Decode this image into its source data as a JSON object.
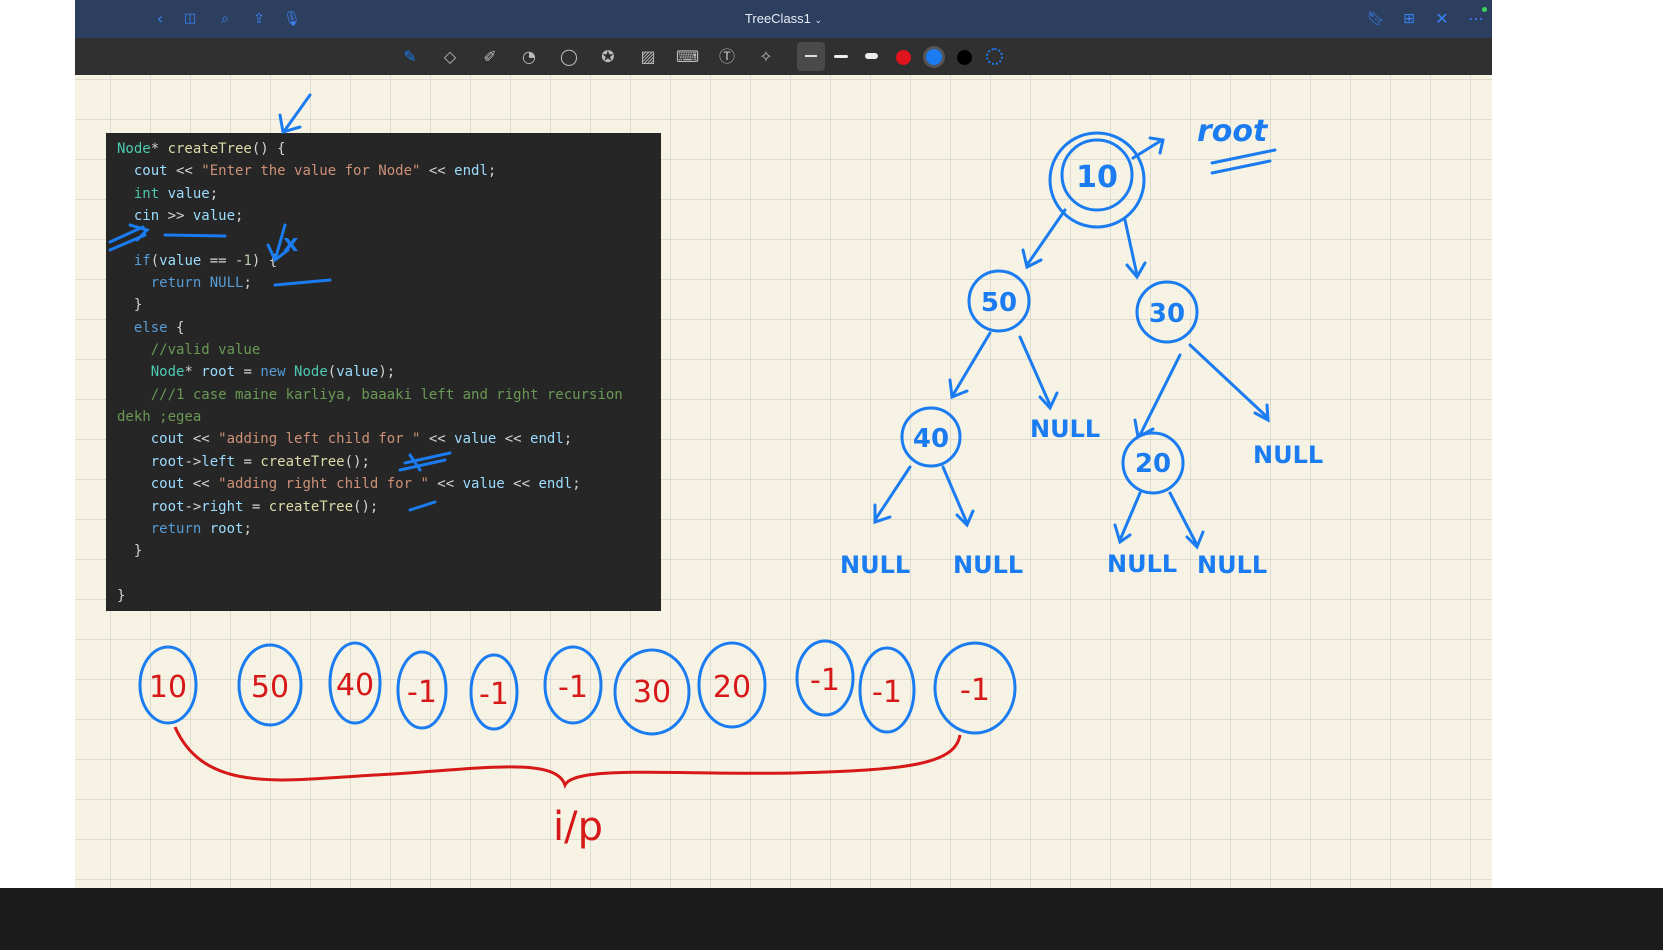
{
  "titlebar": {
    "title": "TreeClass1",
    "title_chevron": "⌄",
    "left_icons": [
      "back-icon",
      "sidebar-icon",
      "search-icon",
      "share-icon",
      "microphone-icon"
    ],
    "right_icons": [
      "bookmark-icon",
      "add-page-icon",
      "close-icon",
      "more-icon"
    ]
  },
  "toolbar": {
    "tools": [
      "pen-icon",
      "eraser-icon",
      "highlighter-icon",
      "shapes-icon",
      "lasso-icon",
      "elements-icon",
      "image-icon",
      "keyboard-icon",
      "text-icon",
      "laser-pointer-icon"
    ],
    "colors": {
      "red": "#e0141e",
      "blue": "#1a7cf0",
      "black": "#000000"
    }
  },
  "code": {
    "lines": [
      "Node* createTree() {",
      "  cout << \"Enter the value for Node\" << endl;",
      "  int value;",
      "  cin >> value;",
      "",
      "  if(value == -1) {",
      "    return NULL;",
      "  }",
      "  else {",
      "    //valid value",
      "    Node* root = new Node(value);",
      "    ///1 case maine karliya, baaaki left and right recursion",
      "dekh ;egea",
      "    cout << \"adding left child for \" << value << endl;",
      "    root->left = createTree();",
      "    cout << \"adding right child for \" << value << endl;",
      "    root->right = createTree();",
      "    return root;",
      "  }",
      "",
      "}"
    ]
  },
  "annotations": {
    "x_mark": "x",
    "root_label": "root",
    "input_label": "i/p"
  },
  "tree": {
    "root": "10",
    "n50": "50",
    "n30": "30",
    "n40": "40",
    "n20": "20",
    "null": "NULL"
  },
  "input_sequence": [
    "10",
    "50",
    "40",
    "-1",
    "-1",
    "-1",
    "30",
    "20",
    "-1",
    "-1",
    "-1"
  ]
}
